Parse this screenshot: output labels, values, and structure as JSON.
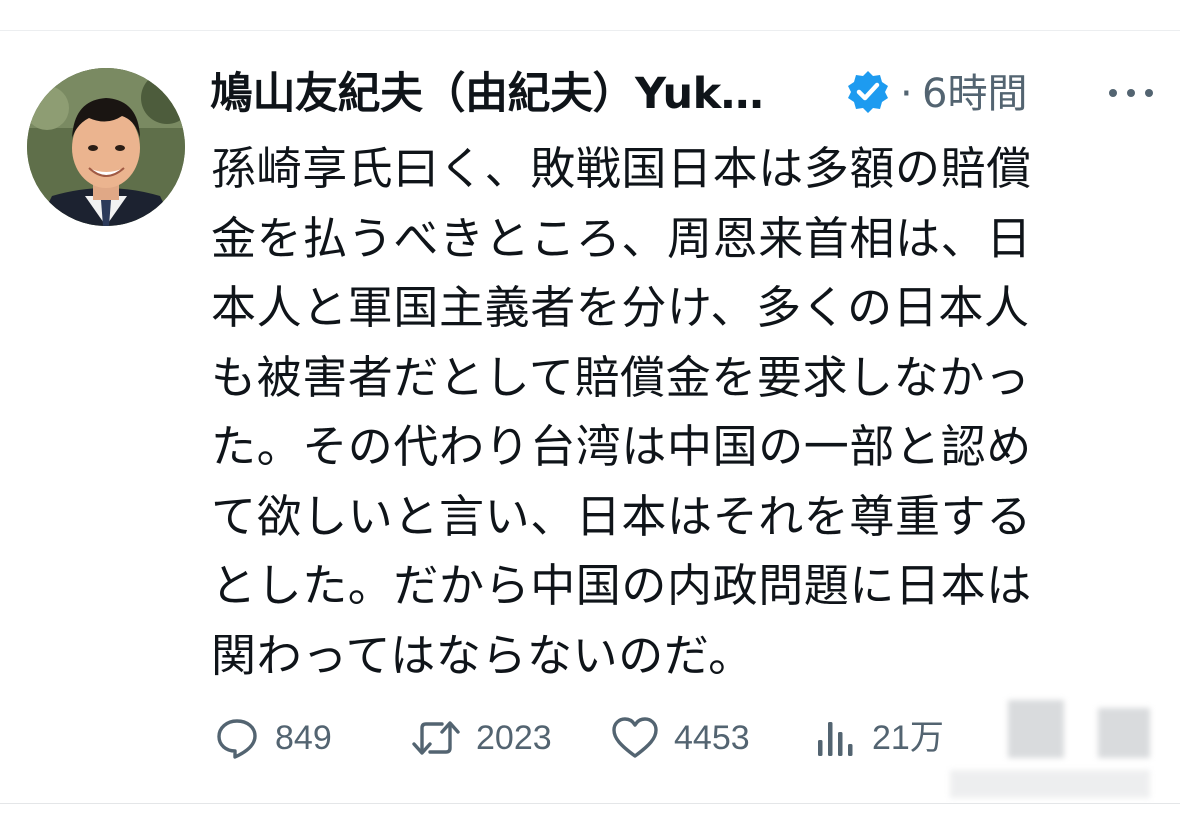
{
  "tweet": {
    "author": {
      "display_name": "鳩山友紀夫（由紀夫）Yuk…",
      "verified": true
    },
    "separator": "·",
    "timestamp": "6時間",
    "text_lines": [
      "孫崎享氏曰く、敗戦国日本は多額の賠償",
      "金を払うべきところ、周恩来首相は、日",
      "本人と軍国主義者を分け、多くの日本人",
      "も被害者だとして賠償金を要求しなかっ",
      "た。その代わり台湾は中国の一部と認め",
      "て欲しいと言い、日本はそれを尊重する",
      "とした。だから中国の内政問題に日本は",
      "関わってはならないのだ。"
    ],
    "stats": {
      "replies": "849",
      "retweets": "2023",
      "likes": "4453",
      "views": "21万"
    }
  },
  "icons": {
    "verified": "verified-badge-icon",
    "more": "more-options-icon",
    "reply": "reply-icon",
    "retweet": "retweet-icon",
    "like": "heart-icon",
    "views": "views-chart-icon"
  },
  "colors": {
    "text": "#0f1419",
    "secondary": "#536471",
    "verified_blue": "#1d9bf0"
  }
}
